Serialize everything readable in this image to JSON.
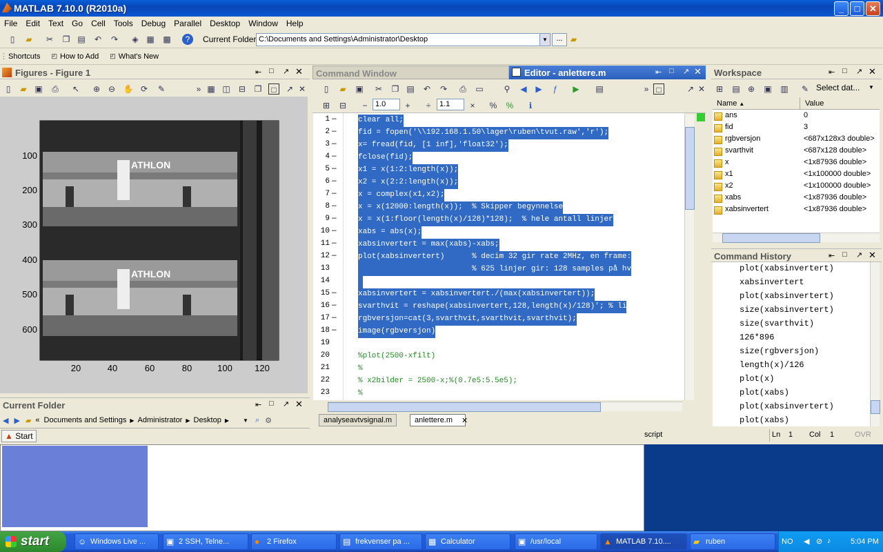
{
  "window": {
    "title": "MATLAB  7.10.0 (R2010a)"
  },
  "menu": [
    "File",
    "Edit",
    "Text",
    "Go",
    "Cell",
    "Tools",
    "Debug",
    "Parallel",
    "Desktop",
    "Window",
    "Help"
  ],
  "toolbar": {
    "current_folder_label": "Current Folder:",
    "current_folder_value": "C:\\Documents and Settings\\Administrator\\Desktop",
    "browse_label": "..."
  },
  "shortcuts": {
    "items": [
      "Shortcuts",
      "How to Add",
      "What's New"
    ]
  },
  "figure": {
    "title": "Figures - Figure 1",
    "y_ticks": [
      "100",
      "200",
      "300",
      "400",
      "500",
      "600"
    ],
    "x_ticks": [
      "20",
      "40",
      "60",
      "80",
      "100",
      "120"
    ],
    "banner_text": "ATHLON"
  },
  "current_folder": {
    "title": "Current Folder",
    "path": [
      "«",
      "Documents and Settings",
      "Administrator",
      "Desktop"
    ]
  },
  "start_button": "Start",
  "command_window": {
    "title": "Command Window"
  },
  "editor": {
    "title": "Editor - anlettere.m",
    "zoom1": "1.0",
    "zoom2": "1.1",
    "lines": [
      {
        "n": "1",
        "dash": true,
        "code": "clear all;",
        "sel": true
      },
      {
        "n": "2",
        "dash": true,
        "code": "fid = fopen('\\\\192.168.1.50\\lager\\ruben\\tvut.raw','r');",
        "sel": true
      },
      {
        "n": "3",
        "dash": true,
        "code": "x= fread(fid, [1 inf],'float32');",
        "sel": true
      },
      {
        "n": "4",
        "dash": true,
        "code": "fclose(fid);",
        "sel": true
      },
      {
        "n": "5",
        "dash": true,
        "code": "x1 = x(1:2:length(x));",
        "sel": true
      },
      {
        "n": "6",
        "dash": true,
        "code": "x2 = x(2:2:length(x));",
        "sel": true
      },
      {
        "n": "7",
        "dash": true,
        "code": "x = complex(x1,x2);",
        "sel": true
      },
      {
        "n": "8",
        "dash": true,
        "code": "x = x(12000:length(x));  % Skipper begynnelse",
        "sel": true
      },
      {
        "n": "9",
        "dash": true,
        "code": "x = x(1:floor(length(x)/128)*128);  % hele antall linjer",
        "sel": true
      },
      {
        "n": "10",
        "dash": true,
        "code": "xabs = abs(x);",
        "sel": true
      },
      {
        "n": "11",
        "dash": true,
        "code": "xabsinvertert = max(xabs)-xabs;",
        "sel": true
      },
      {
        "n": "12",
        "dash": true,
        "code": "plot(xabsinvertert)      % decim 32 gir rate 2MHz, en frame:",
        "sel": true
      },
      {
        "n": "13",
        "dash": false,
        "code": "                         % 625 linjer gir: 128 samples på hv",
        "sel": true
      },
      {
        "n": "14",
        "dash": false,
        "code": " ",
        "sel": true
      },
      {
        "n": "15",
        "dash": true,
        "code": "xabsinvertert = xabsinvertert./(max(xabsinvertert));",
        "sel": true
      },
      {
        "n": "16",
        "dash": true,
        "code": "svarthvit = reshape(xabsinvertert,128,length(x)/128)'; % li",
        "sel": true
      },
      {
        "n": "17",
        "dash": true,
        "code": "rgbversjon=cat(3,svarthvit,svarthvit,svarthvit);",
        "sel": true
      },
      {
        "n": "18",
        "dash": true,
        "code": "image(rgbversjon)",
        "sel": true
      },
      {
        "n": "19",
        "dash": false,
        "code": "",
        "sel": false
      },
      {
        "n": "20",
        "dash": false,
        "code": "%plot(2500-xfilt)",
        "sel": false,
        "comment": true
      },
      {
        "n": "21",
        "dash": false,
        "code": "%",
        "sel": false,
        "comment": true
      },
      {
        "n": "22",
        "dash": false,
        "code": "% x2bilder = 2500-x;%(0.7e5:5.5e5);",
        "sel": false,
        "comment": true
      },
      {
        "n": "23",
        "dash": false,
        "code": "%",
        "sel": false,
        "comment": true
      }
    ],
    "tabs": [
      "analyseavtvsignal.m",
      "anlettere.m"
    ]
  },
  "statusbar": {
    "mode": "script",
    "ln_label": "Ln",
    "ln": "1",
    "col_label": "Col",
    "col": "1",
    "ovr": "OVR"
  },
  "workspace": {
    "title": "Workspace",
    "select_data": "Select dat...",
    "col_name": "Name",
    "col_value": "Value",
    "rows": [
      {
        "name": "ans",
        "value": "0"
      },
      {
        "name": "fid",
        "value": "3"
      },
      {
        "name": "rgbversjon",
        "value": "<687x128x3 double>"
      },
      {
        "name": "svarthvit",
        "value": "<687x128 double>"
      },
      {
        "name": "x",
        "value": "<1x87936 double>"
      },
      {
        "name": "x1",
        "value": "<1x100000 double>"
      },
      {
        "name": "x2",
        "value": "<1x100000 double>"
      },
      {
        "name": "xabs",
        "value": "<1x87936 double>"
      },
      {
        "name": "xabsinvertert",
        "value": "<1x87936 double>"
      }
    ]
  },
  "history": {
    "title": "Command History",
    "items": [
      "plot(xabsinvertert)",
      "xabsinvertert",
      "plot(xabsinvertert)",
      "size(xabsinvertert)",
      "size(svarthvit)",
      "126*896",
      "size(rgbversjon)",
      "length(x)/126",
      "plot(x)",
      "plot(xabs)",
      "plot(xabsinvertert)",
      "plot(xabs)"
    ]
  },
  "taskbar": {
    "start": "start",
    "tasks": [
      "Windows Live ...",
      "2 SSH, Telne...",
      "2 Firefox",
      "frekvenser pa ...",
      "Calculator",
      "/usr/local",
      "MATLAB  7.10....",
      "ruben"
    ],
    "lang": "NO",
    "clock": "5:04 PM"
  }
}
